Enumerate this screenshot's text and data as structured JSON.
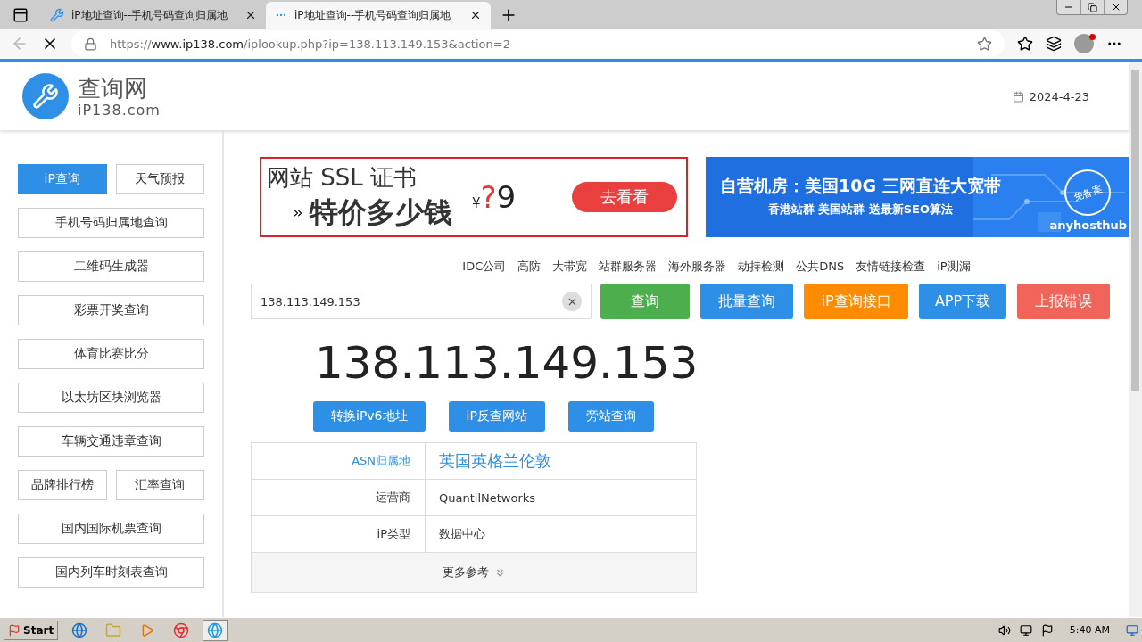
{
  "browser": {
    "tabs": [
      {
        "title": "iP地址查询--手机号码查询归属地",
        "selected": false
      },
      {
        "title": "iP地址查询--手机号码查询归属地",
        "selected": true
      }
    ],
    "url": {
      "scheme": "https://",
      "host": "www.ip138.com",
      "path": "/iplookup.php?ip=138.113.149.153&action=2"
    }
  },
  "header": {
    "logo_title": "查询网",
    "logo_subtitle": "iP138.com",
    "date": "2024-4-23"
  },
  "sidebar": {
    "rows": [
      [
        {
          "label": "iP查询",
          "selected": true
        },
        {
          "label": "天气预报",
          "selected": false
        }
      ],
      [
        {
          "label": "手机号码归属地查询",
          "selected": false
        }
      ],
      [
        {
          "label": "二维码生成器",
          "selected": false
        }
      ],
      [
        {
          "label": "彩票开奖查询",
          "selected": false
        }
      ],
      [
        {
          "label": "体育比赛比分",
          "selected": false
        }
      ],
      [
        {
          "label": "以太坊区块浏览器",
          "selected": false
        }
      ],
      [
        {
          "label": "车辆交通违章查询",
          "selected": false
        }
      ],
      [
        {
          "label": "品牌排行榜",
          "selected": false
        },
        {
          "label": "汇率查询",
          "selected": false
        }
      ],
      [
        {
          "label": "国内国际机票查询",
          "selected": false
        }
      ],
      [
        {
          "label": "国内列车时刻表查询",
          "selected": false
        }
      ]
    ]
  },
  "ads": {
    "ssl": {
      "title": "网站 SSL 证书",
      "slogan": "特价多少钱",
      "currency": "¥",
      "mystery": "?",
      "digit": "9",
      "button": "去看看"
    },
    "host": {
      "headline": "自营机房：美国10G 三网直连大宽带",
      "subline": "香港站群 美国站群 送最新SEO算法",
      "stamp": "免备案",
      "brand": "anyhosthub"
    }
  },
  "nav_links": [
    "IDC公司",
    "高防",
    "大带宽",
    "站群服务器",
    "海外服务器",
    "劫持检测",
    "公共DNS",
    "友情链接检查",
    "iP测漏"
  ],
  "search": {
    "value": "138.113.149.153",
    "buttons": [
      {
        "label": "查询",
        "color": "#4cae4c"
      },
      {
        "label": "批量查询",
        "color": "#2d8fe6"
      },
      {
        "label": "iP查询接口",
        "color": "#ff8c00"
      },
      {
        "label": "APP下载",
        "color": "#2d8fe6"
      },
      {
        "label": "上报错误",
        "color": "#f0645a"
      }
    ]
  },
  "result": {
    "ip": "138.113.149.153",
    "actions": [
      "转换iPv6地址",
      "iP反查网站",
      "旁站查询"
    ],
    "rows": [
      {
        "label": "ASN归属地",
        "value": "英国英格兰伦敦",
        "kind": "highlight"
      },
      {
        "label": "运营商",
        "value": "QuantilNetworks",
        "kind": "plain"
      },
      {
        "label": "iP类型",
        "value": "数据中心",
        "kind": "plain"
      }
    ],
    "more": "更多参考"
  },
  "taskbar": {
    "start": "Start",
    "time": "5:40 AM"
  }
}
